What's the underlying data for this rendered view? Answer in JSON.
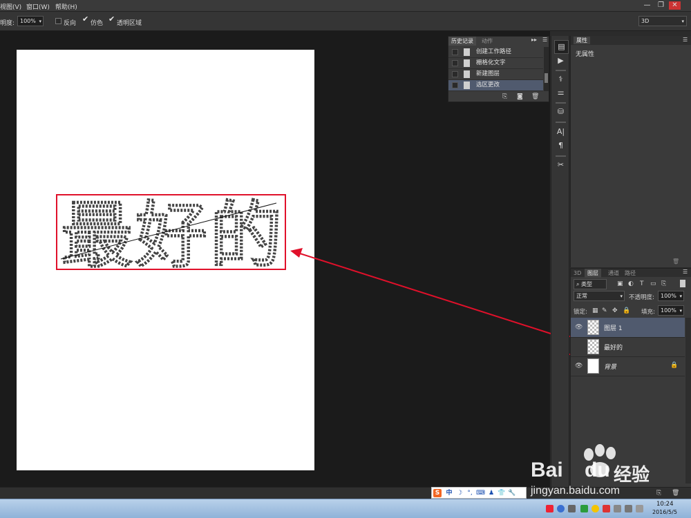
{
  "menu": {
    "items": [
      "视图(V)",
      "窗口(W)",
      "帮助(H)"
    ]
  },
  "window_controls": {
    "minimize": "—",
    "restore": "❐",
    "close": "✕"
  },
  "options": {
    "opacity_label": "明度:",
    "opacity_value": "100%",
    "reverse_label": "反向",
    "dither_label": "仿色",
    "transparency_label": "透明区域",
    "workspace_value": "3D"
  },
  "history_panel": {
    "tabs": [
      "历史记录",
      "动作"
    ],
    "items": [
      "创建工作路径",
      "栅格化文字",
      "新建图层",
      "选区更改"
    ],
    "selected_index": 3
  },
  "properties_panel": {
    "title": "属性",
    "content": "无属性"
  },
  "layers_panel": {
    "tabs": [
      "3D",
      "图层",
      "通道",
      "路径"
    ],
    "active_tab": "图层",
    "filter_label": "类型",
    "blend_mode": "正常",
    "opacity_label": "不透明度:",
    "opacity_value": "100%",
    "lock_label": "锁定:",
    "fill_label": "填充:",
    "fill_value": "100%",
    "layers": [
      {
        "name": "图层 1",
        "visible": true,
        "selected": true
      },
      {
        "name": "最好的",
        "visible": false,
        "selected": false
      },
      {
        "name": "背景",
        "visible": true,
        "selected": false
      }
    ]
  },
  "canvas": {
    "selection_text": "最好的"
  },
  "ime_bar": {
    "logo": "S",
    "mode": "中"
  },
  "taskbar": {
    "time": "10:24",
    "date": "2016/5/5"
  },
  "watermark": {
    "brand": "Bai",
    "brand2": "du",
    "site": "经验",
    "url": "jingyan.baidu.com"
  },
  "colors": {
    "annotation": "#e0102a",
    "selected_row": "#505a6e",
    "panel": "#3a3a3a"
  }
}
